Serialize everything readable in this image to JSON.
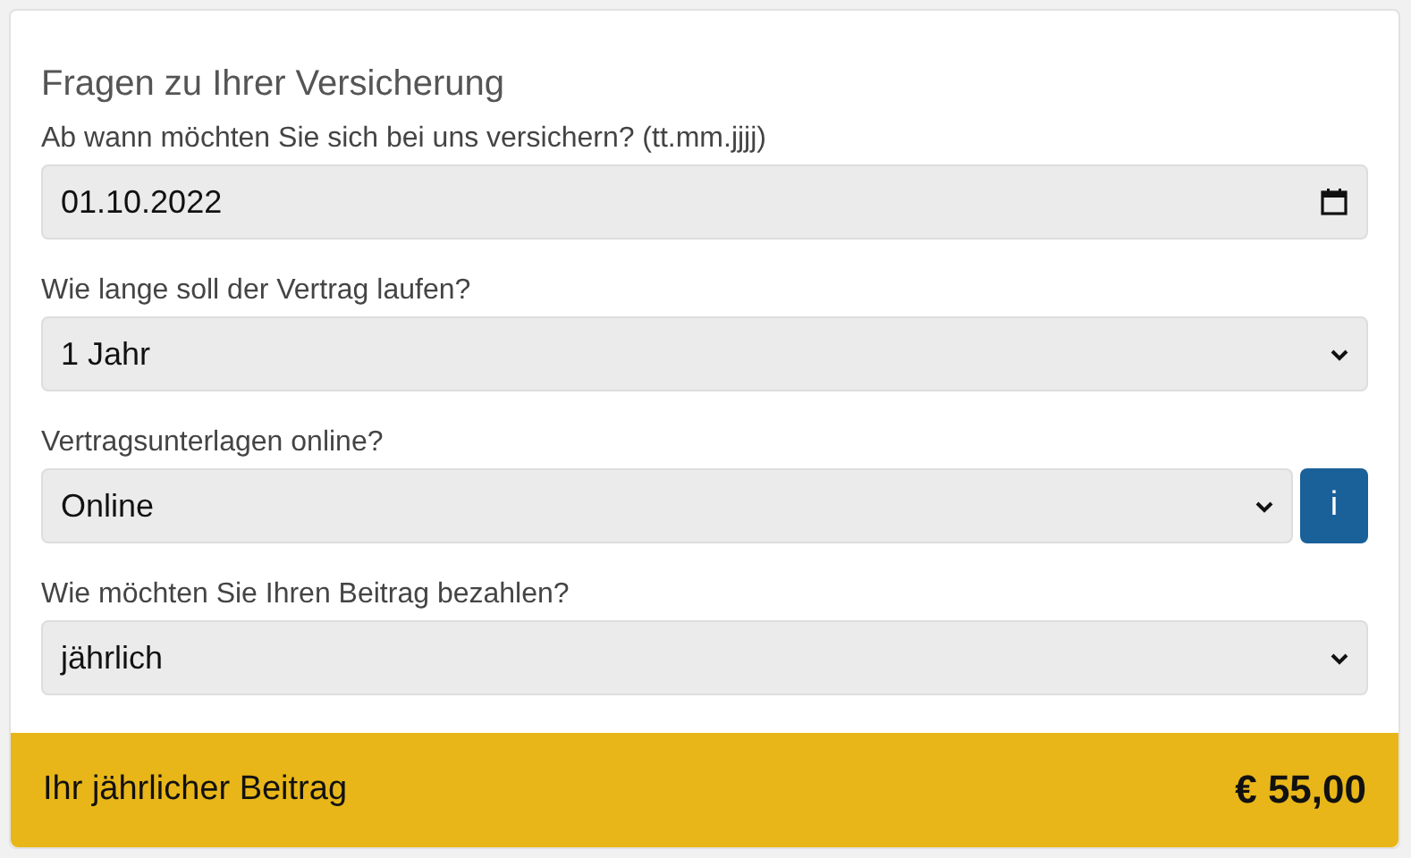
{
  "title": "Fragen zu Ihrer Versicherung",
  "questions": [
    {
      "label": "Ab wann möchten Sie sich bei uns versichern? (tt.mm.jjjj)",
      "kind": "date",
      "value": "01.10.2022"
    },
    {
      "label": "Wie lange soll der Vertrag laufen?",
      "kind": "select",
      "value": "1 Jahr"
    },
    {
      "label": "Vertragsunterlagen online?",
      "kind": "select",
      "value": "Online",
      "info": "i"
    },
    {
      "label": "Wie möchten Sie Ihren Beitrag bezahlen?",
      "kind": "select",
      "value": "jährlich"
    }
  ],
  "total": {
    "label": "Ihr jährlicher Beitrag",
    "amount": "€ 55,00"
  }
}
